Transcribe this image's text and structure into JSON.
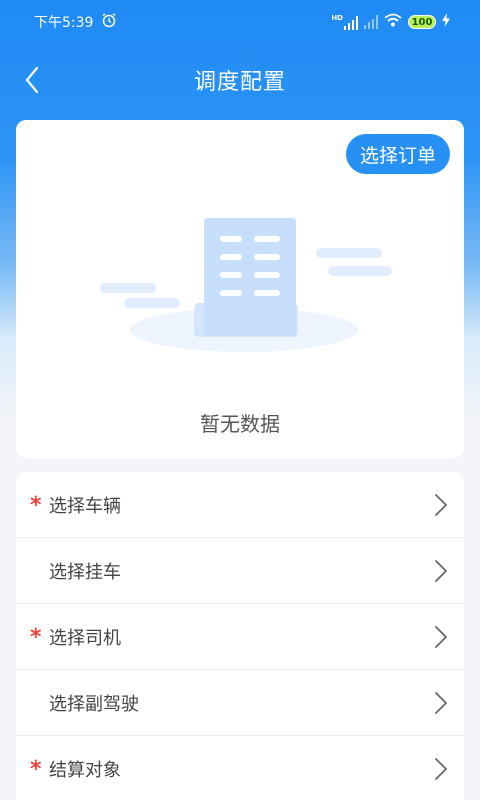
{
  "status_bar": {
    "time": "下午5:39",
    "alarm_icon": "alarm-clock-icon",
    "hd_label": "HD",
    "battery": "100"
  },
  "header": {
    "title": "调度配置",
    "back_icon": "chevron-left-icon"
  },
  "order_card": {
    "select_order_label": "选择订单",
    "empty_text": "暂无数据",
    "illustration_icon": "empty-document-illustration"
  },
  "options": [
    {
      "label": "选择车辆",
      "required": "*"
    },
    {
      "label": "选择挂车",
      "required": ""
    },
    {
      "label": "选择司机",
      "required": "*"
    },
    {
      "label": "选择副驾驶",
      "required": ""
    },
    {
      "label": "结算对象",
      "required": "*"
    }
  ],
  "colors": {
    "primary": "#2690f5",
    "required": "#f0433a",
    "battery": "#b7f05b"
  }
}
